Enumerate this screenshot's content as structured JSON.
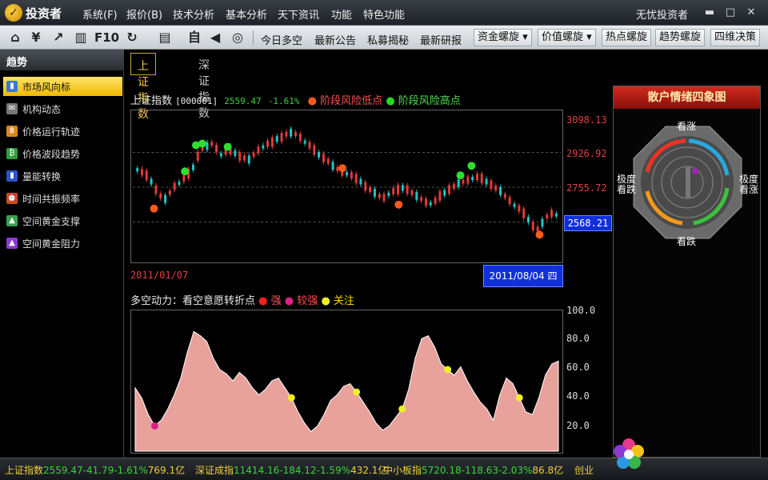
{
  "app": {
    "name": "投资者",
    "window_title": "无忧投资者"
  },
  "menu": [
    "系统(F)",
    "报价(B)",
    "技术分析",
    "基本分析",
    "天下资讯",
    "功能",
    "特色功能"
  ],
  "toolbar": {
    "icons": [
      "home-icon",
      "yen-icon",
      "chart-icon",
      "bars-icon"
    ],
    "f10": "F10",
    "links": [
      "今日多空",
      "最新公告",
      "私募揭秘",
      "最新研报"
    ],
    "dropdowns": [
      "资金螺旋",
      "价值螺旋"
    ],
    "buttons": [
      "热点螺旋",
      "趋势螺旋",
      "四维决策"
    ]
  },
  "sidebar": {
    "title": "趋势",
    "items": [
      {
        "label": "市场风向标",
        "active": true,
        "color": "#3a7bd5"
      },
      {
        "label": "机构动态",
        "active": false,
        "color": "#777777"
      },
      {
        "label": "价格运行轨迹",
        "active": false,
        "color": "#d9891a"
      },
      {
        "label": "价格波段趋势",
        "active": false,
        "color": "#2e9e3a"
      },
      {
        "label": "量能转换",
        "active": false,
        "color": "#2a55c9"
      },
      {
        "label": "时间共振频率",
        "active": false,
        "color": "#d04a1c"
      },
      {
        "label": "空间黄金支撑",
        "active": false,
        "color": "#3aa050"
      },
      {
        "label": "空间黄金阻力",
        "active": false,
        "color": "#8a3ad0"
      }
    ]
  },
  "tabs": [
    "上证指数",
    "深证指数"
  ],
  "kline": {
    "name": "上证指数",
    "code": "[000001]",
    "price": "2559.47",
    "change": "-1.61%",
    "legend_low": "阶段风险低点",
    "legend_high": "阶段风险高点",
    "price_labels": [
      "3098.13",
      "2926.92",
      "2755.72"
    ],
    "current_price_label": "2568.21",
    "start_date": "2011/01/07",
    "cursor_date": "2011/08/04 四"
  },
  "sentiment": {
    "title": "多空动力：看空意愿转折点",
    "legend": [
      "强",
      "较强",
      "关注"
    ],
    "y_labels": [
      "100.0",
      "80.0",
      "60.0",
      "40.0",
      "20.0"
    ]
  },
  "chart_data": [
    {
      "type": "line",
      "name": "多空动力",
      "y_range": [
        0,
        100
      ],
      "values": [
        45,
        38,
        26,
        18,
        22,
        30,
        40,
        52,
        70,
        85,
        82,
        78,
        66,
        58,
        55,
        50,
        56,
        52,
        45,
        40,
        44,
        50,
        52,
        45,
        38,
        28,
        20,
        14,
        18,
        26,
        36,
        40,
        46,
        48,
        42,
        35,
        28,
        20,
        15,
        18,
        24,
        30,
        44,
        66,
        80,
        82,
        74,
        62,
        58,
        54,
        60,
        50,
        42,
        35,
        30,
        22,
        40,
        52,
        48,
        38,
        28,
        26,
        38,
        54,
        62,
        64
      ],
      "markers": [
        {
          "index": 3,
          "strength": "较强"
        },
        {
          "index": 24,
          "strength": "关注"
        },
        {
          "index": 34,
          "strength": "关注"
        },
        {
          "index": 41,
          "strength": "关注"
        },
        {
          "index": 48,
          "strength": "关注"
        },
        {
          "index": 59,
          "strength": "关注"
        }
      ]
    }
  ],
  "quadrant": {
    "title": "散户情绪四象图",
    "labels": [
      "看涨",
      "极度看涨",
      "看跌",
      "极度看跌"
    ]
  },
  "status": [
    {
      "label": "上证指数",
      "value": "2559.47",
      "change": "-41.79",
      "pct": "-1.61%",
      "amount": "769.1亿"
    },
    {
      "label": "深证成指",
      "value": "11414.16",
      "change": "-184.12",
      "pct": "-1.59%",
      "amount": "432.1亿"
    },
    {
      "label": "中小板指",
      "value": "5720.18",
      "change": "-118.63",
      "pct": "-2.03%",
      "amount": "86.8亿"
    },
    {
      "label": "创业",
      "value": "",
      "change": "",
      "pct": "",
      "amount": ""
    }
  ],
  "colors": {
    "up": "#e23a3a",
    "down": "#22c5c5",
    "accent": "#f5c84c",
    "area_fill": "#e8a19b"
  }
}
